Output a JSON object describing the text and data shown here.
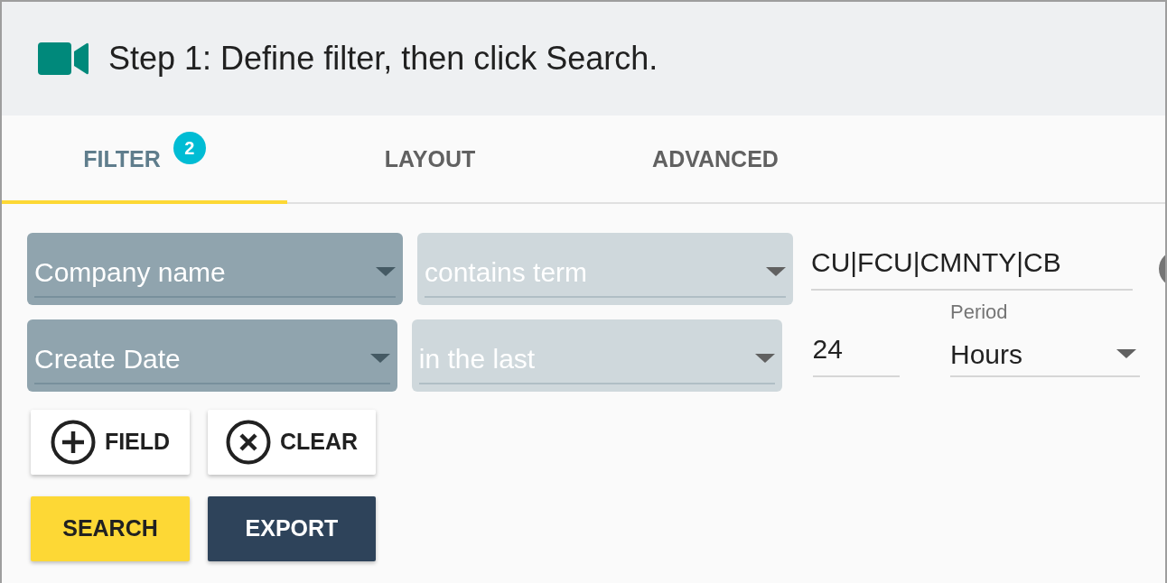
{
  "header": {
    "title": "Step 1: Define filter, then click Search."
  },
  "tabs": [
    {
      "label": "FILTER",
      "selected": true,
      "badge": "2"
    },
    {
      "label": "LAYOUT",
      "selected": false
    },
    {
      "label": "ADVANCED",
      "selected": false
    }
  ],
  "filters": [
    {
      "kind": "text",
      "field": {
        "value": "Company name",
        "disabled": false
      },
      "operator": {
        "value": "contains term",
        "disabled": true
      },
      "value": "CU|FCU|CMNTY|CB"
    },
    {
      "kind": "period",
      "field": {
        "value": "Create Date",
        "disabled": false
      },
      "operator": {
        "value": "in the last",
        "disabled": true
      },
      "value": "24",
      "period_label": "Period",
      "period": "Hours"
    }
  ],
  "buttons": [
    {
      "kind": "add",
      "label": "FIELD"
    },
    {
      "kind": "clear",
      "label": "CLEAR"
    }
  ],
  "actions": [
    {
      "kind": "primary",
      "label": "SEARCH"
    },
    {
      "kind": "dark",
      "label": "EXPORT"
    }
  ]
}
